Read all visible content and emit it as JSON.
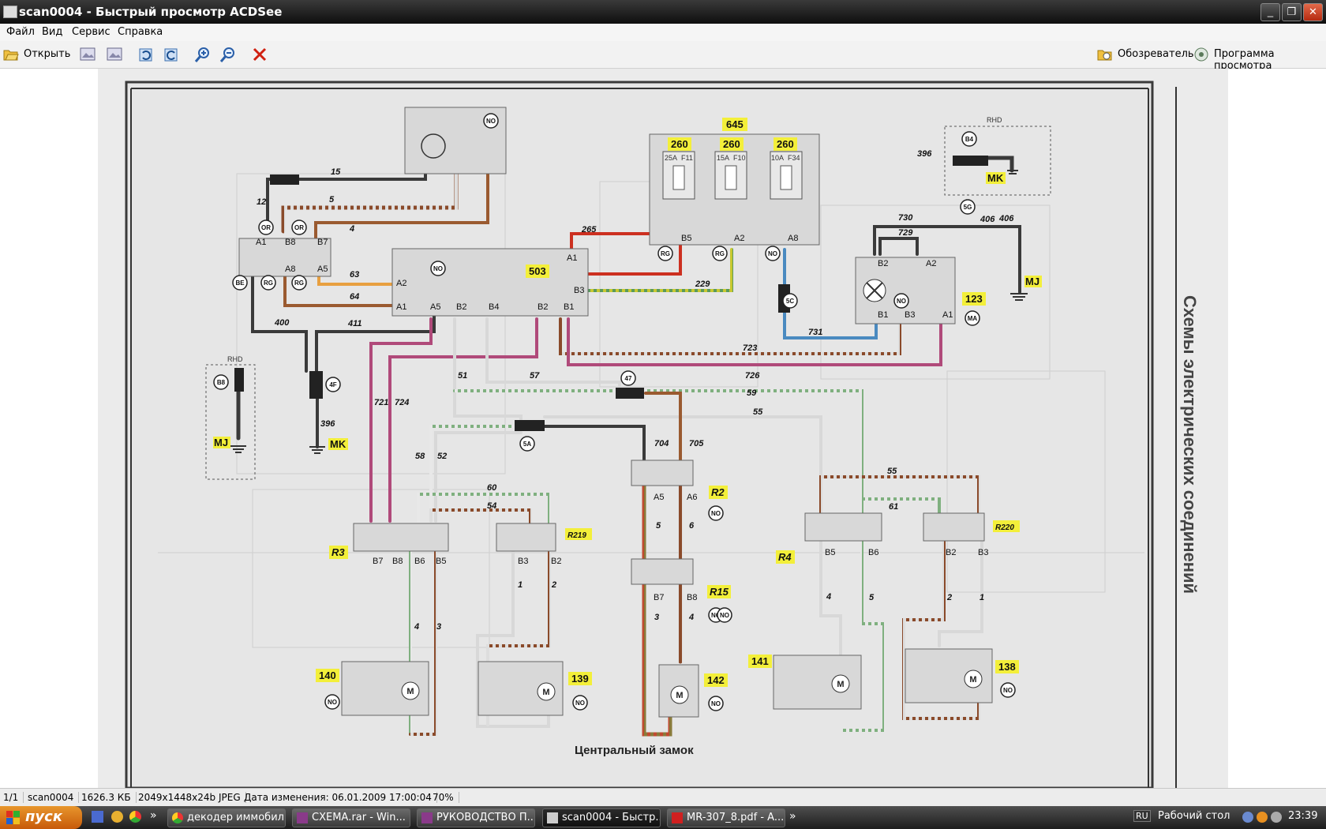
{
  "window": {
    "title": "scan0004 - Быстрый просмотр ACDSee",
    "min": "_",
    "restore": "❐",
    "close": "✕"
  },
  "menu": [
    "Файл",
    "Вид",
    "Сервис",
    "Справка"
  ],
  "toolbar": {
    "open": "Открыть",
    "browser": "Обозреватель",
    "viewer": "Программа просмотра"
  },
  "diagram": {
    "caption": "Центральный замок",
    "side_title": "Схемы электрических соединений",
    "components": {
      "c645": "645",
      "c503": "503",
      "c123": "123",
      "c140": "140",
      "c139": "139",
      "c142": "142",
      "c141": "141",
      "c138": "138",
      "r3": "R3",
      "r219": "R219",
      "r2": "R2",
      "r15": "R15",
      "r4": "R4",
      "r220": "R220",
      "f260": "260",
      "f11": "F11",
      "f10": "F10",
      "f34": "F34",
      "a25": "25A",
      "a15": "15A",
      "a10": "10A",
      "rhd": "RHD",
      "mk": "MK",
      "mj": "MJ"
    },
    "badges": [
      "NO",
      "OR",
      "OR",
      "BE",
      "RG",
      "RG",
      "NO",
      "RG",
      "RG",
      "NO",
      "NO",
      "5C",
      "MA",
      "4F",
      "47",
      "5A",
      "B8",
      "B4",
      "5G",
      "NO",
      "NO",
      "NO",
      "NO",
      "NO",
      "NO",
      "NO"
    ],
    "wire_numbers": [
      "15",
      "12",
      "5",
      "4",
      "63",
      "64",
      "400",
      "411",
      "265",
      "229",
      "731",
      "730",
      "729",
      "406",
      "723",
      "726",
      "721",
      "724",
      "51",
      "57",
      "59",
      "55",
      "58",
      "52",
      "704",
      "705",
      "60",
      "54",
      "5",
      "6",
      "4",
      "3",
      "1",
      "2",
      "4",
      "5",
      "2",
      "1",
      "55",
      "61",
      "396",
      "406",
      "396",
      "3",
      "4"
    ],
    "pins": [
      "A1",
      "B8",
      "B7",
      "A8",
      "A5",
      "A2",
      "A1",
      "A5",
      "B2",
      "B4",
      "B2",
      "B1",
      "A1",
      "B3",
      "B5",
      "A2",
      "A8",
      "B2",
      "A2",
      "B1",
      "B3",
      "A1",
      "B7",
      "B8",
      "B6",
      "B5",
      "B3",
      "B2",
      "A5",
      "A6",
      "B7",
      "B8",
      "B5",
      "B6",
      "B2",
      "B3"
    ]
  },
  "status": {
    "page": "1/1",
    "name": "scan0004",
    "size": "1626.3 КБ",
    "info": "2049x1448x24b JPEG",
    "date": "Дата изменения: 06.01.2009 17:00:04",
    "zoom": "70%"
  },
  "taskbar": {
    "start": "пуск",
    "tasks": [
      "декодер иммобил...",
      "СХЕМА.rar - Win...",
      "РУКОВОДСТВО П...",
      "scan0004 - Быстр...",
      "MR-307_8.pdf - A..."
    ],
    "lang": "RU",
    "desktop": "Рабочий стол",
    "clock": "23:39"
  }
}
